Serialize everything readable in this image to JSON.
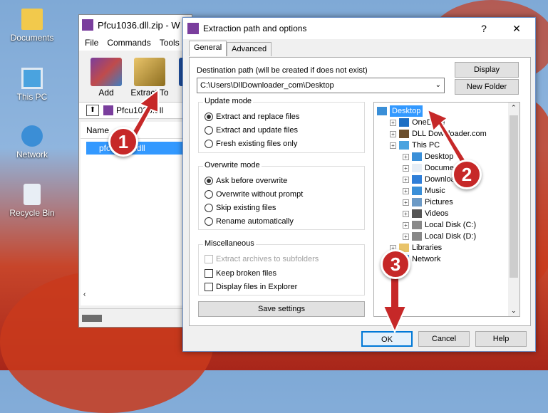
{
  "desktop": {
    "icons": [
      {
        "label": "Documents",
        "icon": "folder-icon"
      },
      {
        "label": "This PC",
        "icon": "computer-icon"
      },
      {
        "label": "Network",
        "icon": "network-icon"
      },
      {
        "label": "Recycle Bin",
        "icon": "recycle-bin-icon"
      }
    ]
  },
  "winrar": {
    "title": "Pfcu1036.dll.zip - W",
    "menu": [
      "File",
      "Commands",
      "Tools"
    ],
    "tools": [
      {
        "label": "Add",
        "icon": "winrar-add-icon"
      },
      {
        "label": "Extract To",
        "icon": "extract-to-icon"
      }
    ],
    "path": "Pfcu1036.dll",
    "column_name": "Name",
    "file": "pfcu1036.dll"
  },
  "dialog": {
    "title": "Extraction path and options",
    "help": "?",
    "close": "✕",
    "tabs": [
      "General",
      "Advanced"
    ],
    "dest_label": "Destination path (will be created if does not exist)",
    "dest_value": "C:\\Users\\DllDownloader_com\\Desktop",
    "display_button": "Display",
    "new_folder_button": "New Folder",
    "update_mode": {
      "title": "Update mode",
      "options": [
        "Extract and replace files",
        "Extract and update files",
        "Fresh existing files only"
      ],
      "selected": 0
    },
    "overwrite_mode": {
      "title": "Overwrite mode",
      "options": [
        "Ask before overwrite",
        "Overwrite without prompt",
        "Skip existing files",
        "Rename automatically"
      ],
      "selected": 0
    },
    "misc": {
      "title": "Miscellaneous",
      "options": [
        {
          "label": "Extract archives to subfolders",
          "disabled": true
        },
        {
          "label": "Keep broken files",
          "disabled": false
        },
        {
          "label": "Display files in Explorer",
          "disabled": false
        }
      ]
    },
    "save_settings": "Save settings",
    "tree": [
      {
        "label": "Desktop",
        "level": 0,
        "selected": true,
        "icon": "desktop-icon"
      },
      {
        "label": "OneDrive",
        "level": 1,
        "icon": "onedrive-icon"
      },
      {
        "label": "DLL Downloader.com",
        "level": 1,
        "icon": "user-icon"
      },
      {
        "label": "This PC",
        "level": 1,
        "icon": "computer-icon"
      },
      {
        "label": "Desktop",
        "level": 2,
        "icon": "desktop-icon"
      },
      {
        "label": "Documents",
        "level": 2,
        "icon": "documents-icon"
      },
      {
        "label": "Downloads",
        "level": 2,
        "icon": "downloads-icon"
      },
      {
        "label": "Music",
        "level": 2,
        "icon": "music-icon"
      },
      {
        "label": "Pictures",
        "level": 2,
        "icon": "pictures-icon"
      },
      {
        "label": "Videos",
        "level": 2,
        "icon": "videos-icon"
      },
      {
        "label": "Local Disk (C:)",
        "level": 2,
        "icon": "disk-icon"
      },
      {
        "label": "Local Disk (D:)",
        "level": 2,
        "icon": "disk-icon"
      },
      {
        "label": "Libraries",
        "level": 1,
        "icon": "libraries-icon"
      },
      {
        "label": "Network",
        "level": 1,
        "icon": "network-icon"
      }
    ],
    "ok": "OK",
    "cancel": "Cancel",
    "help_button": "Help"
  },
  "annotations": {
    "steps": [
      "1",
      "2",
      "3"
    ],
    "color": "#c62828"
  }
}
